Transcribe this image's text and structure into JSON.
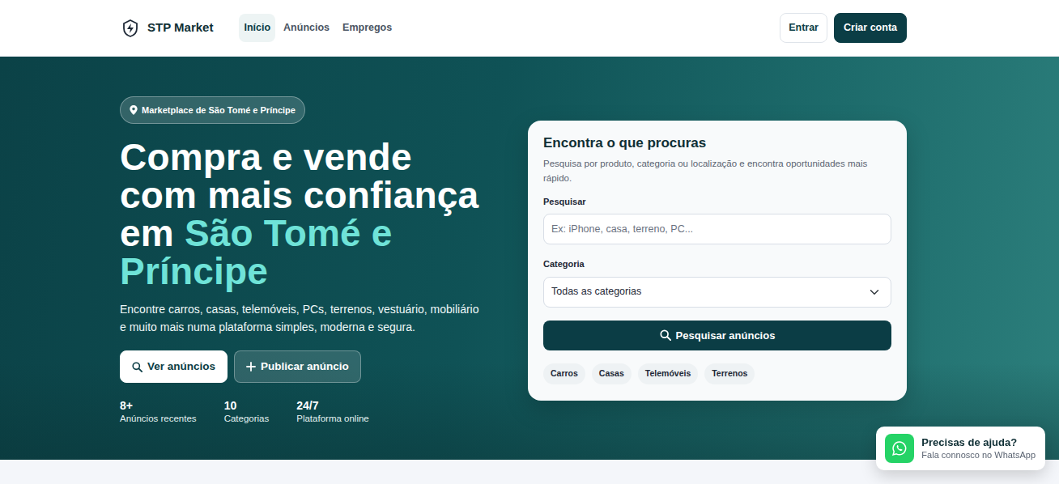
{
  "brand": {
    "name": "STP Market"
  },
  "nav": [
    {
      "label": "Início",
      "selected": true
    },
    {
      "label": "Anúncios",
      "selected": false
    },
    {
      "label": "Empregos",
      "selected": false
    }
  ],
  "auth": {
    "login": "Entrar",
    "signup": "Criar conta"
  },
  "hero": {
    "badge": "Marketplace de São Tomé e Príncipe",
    "title_lines": [
      [
        {
          "text": "Compra e vende",
          "highlight": false
        }
      ],
      [
        {
          "text": "com mais confiança",
          "highlight": false
        }
      ],
      [
        {
          "text": "em ",
          "highlight": false
        },
        {
          "text": "São Tomé e",
          "highlight": true
        }
      ],
      [
        {
          "text": "Príncipe",
          "highlight": true
        }
      ]
    ],
    "description": "Encontre carros, casas, telemóveis, PCs, terrenos, vestuário, mobiliário e muito mais numa plataforma simples, moderna e segura.",
    "buttons": [
      {
        "label": "Ver anúncios",
        "kind": "primary"
      },
      {
        "label": "Publicar anúncio",
        "kind": "secondary"
      }
    ],
    "stats": [
      {
        "value": "8+",
        "label": "Anúncios recentes"
      },
      {
        "value": "10",
        "label": "Categorias"
      },
      {
        "value": "24/7",
        "label": "Plataforma online"
      }
    ]
  },
  "search": {
    "title": "Encontra o que procuras",
    "subtitle": "Pesquisa por produto, categoria ou localização e encontra oportunidades mais rápido.",
    "query_label": "Pesquisar",
    "placeholder": "Ex: iPhone, casa, terreno, PC...",
    "category_label": "Categoria",
    "category_value": "Todas as categorias",
    "button": "Pesquisar anúncios",
    "chips": [
      "Carros",
      "Casas",
      "Telemóveis",
      "Terrenos"
    ]
  },
  "help": {
    "title": "Precisas de ajuda?",
    "subtitle": "Fala connosco no WhatsApp"
  }
}
